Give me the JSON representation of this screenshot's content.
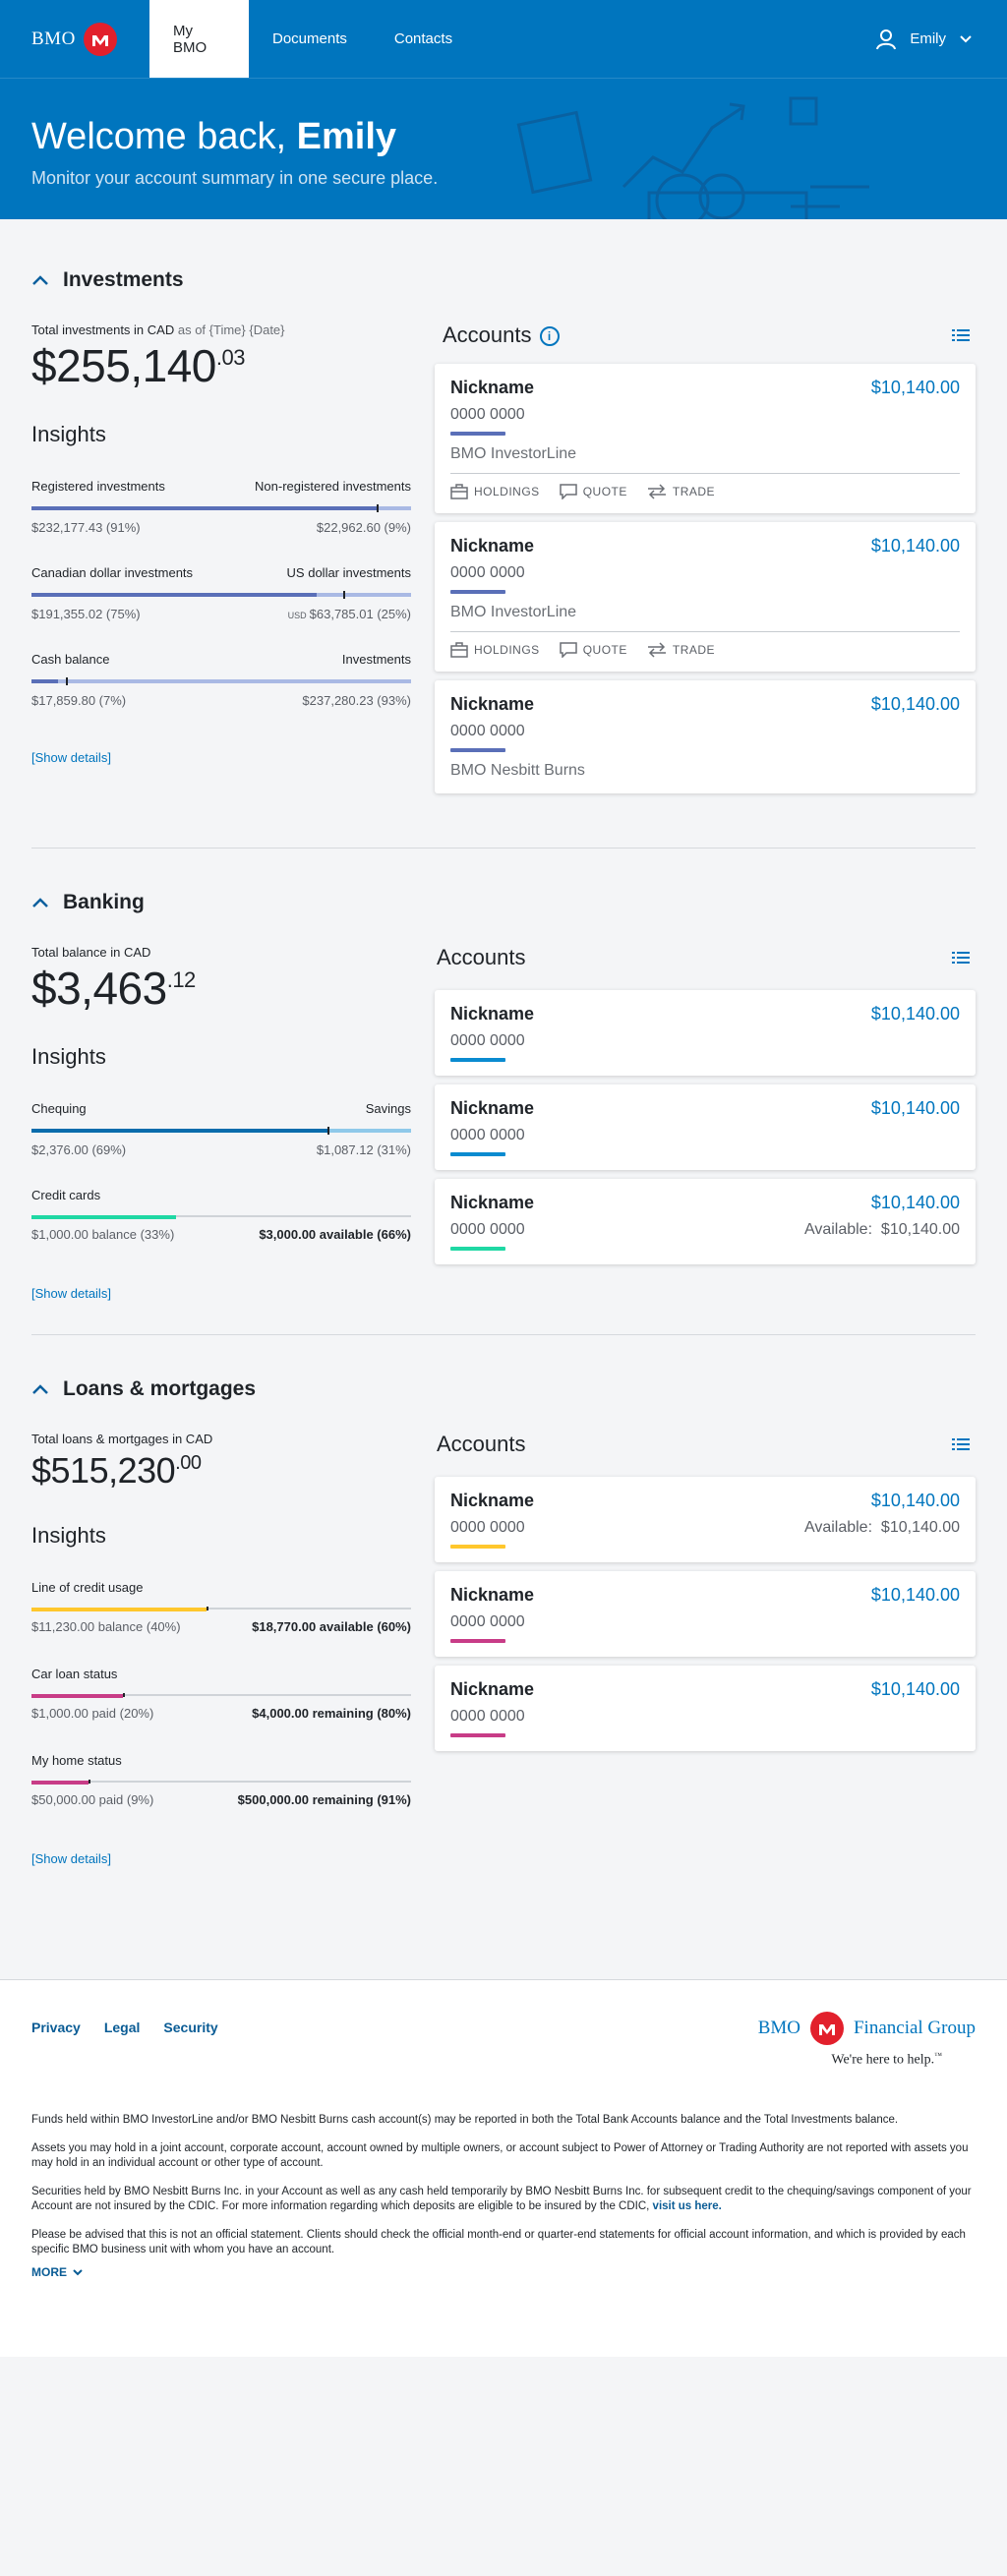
{
  "nav": {
    "brand": "BMO",
    "tabs": [
      "My BMO",
      "Documents",
      "Contacts"
    ],
    "user_name": "Emily"
  },
  "hero": {
    "greeting": "Welcome back,",
    "name": "Emily",
    "subtitle": "Monitor your account summary in one secure place."
  },
  "investments": {
    "title": "Investments",
    "total_label": "Total investments in CAD",
    "total_asof": "as of {Time} {Date}",
    "total_whole": "$255,140",
    "total_cents": ".03",
    "insights_title": "Insights",
    "insights": [
      {
        "left_label": "Registered investments",
        "right_label": "Non-registered investments",
        "left_value": "$232,177.43 (91%)",
        "right_value": "$22,962.60 (9%)",
        "fraction": 0.91
      },
      {
        "left_label": "Canadian dollar investments",
        "right_label": "US dollar investments",
        "left_value": "$191,355.02 (75%)",
        "right_currency": "USD",
        "right_value": "$63,785.01 (25%)",
        "fraction": 0.75
      },
      {
        "left_label": "Cash balance",
        "right_label": "Investments",
        "left_value": "$17,859.80 (7%)",
        "right_value": "$237,280.23 (93%)",
        "fraction": 0.07
      }
    ],
    "show_details": "[Show details]",
    "accounts_title": "Accounts",
    "accounts": [
      {
        "nickname": "Nickname",
        "amount": "$10,140.00",
        "number": "0000 0000",
        "provider": "BMO InvestorLine",
        "actions": [
          "HOLDINGS",
          "QUOTE",
          "TRADE"
        ]
      },
      {
        "nickname": "Nickname",
        "amount": "$10,140.00",
        "number": "0000 0000",
        "provider": "BMO InvestorLine",
        "actions": [
          "HOLDINGS",
          "QUOTE",
          "TRADE"
        ]
      },
      {
        "nickname": "Nickname",
        "amount": "$10,140.00",
        "number": "0000 0000",
        "provider": "BMO Nesbitt Burns"
      }
    ]
  },
  "banking": {
    "title": "Banking",
    "total_label": "Total balance in CAD",
    "total_whole": "$3,463",
    "total_cents": ".12",
    "insights_title": "Insights",
    "insights": [
      {
        "left_label": "Chequing",
        "right_label": "Savings",
        "left_value": "$2,376.00 (69%)",
        "right_value": "$1,087.12 (31%)",
        "fraction": 0.69
      },
      {
        "left_label": "Credit cards",
        "right_label": "",
        "left_value": "$1,000.00 balance (33%)",
        "right_value": "$3,000.00 available (66%)",
        "fraction": 0.33
      }
    ],
    "show_details": "[Show details]",
    "accounts_title": "Accounts",
    "accounts": [
      {
        "nickname": "Nickname",
        "amount": "$10,140.00",
        "number": "0000 0000"
      },
      {
        "nickname": "Nickname",
        "amount": "$10,140.00",
        "number": "0000 0000"
      },
      {
        "nickname": "Nickname",
        "amount": "$10,140.00",
        "number": "0000 0000",
        "available_label": "Available:",
        "available_value": "$10,140.00"
      }
    ]
  },
  "loans": {
    "title": "Loans & mortgages",
    "total_label": "Total loans & mortgages in CAD",
    "total_whole": "$515,230",
    "total_cents": ".00",
    "insights_title": "Insights",
    "insights": [
      {
        "left_label": "Line of credit usage",
        "left_value": "$11,230.00 balance (40%)",
        "right_value": "$18,770.00 available (60%)",
        "fraction": 0.4
      },
      {
        "left_label": "Car loan status",
        "left_value": "$1,000.00 paid (20%)",
        "right_value": "$4,000.00 remaining (80%)",
        "fraction": 0.2
      },
      {
        "left_label": "My home status",
        "left_value": "$50,000.00 paid (9%)",
        "right_value": "$500,000.00 remaining (91%)",
        "fraction": 0.09
      }
    ],
    "show_details": "[Show details]",
    "accounts_title": "Accounts",
    "accounts": [
      {
        "nickname": "Nickname",
        "amount": "$10,140.00",
        "number": "0000 0000",
        "available_label": "Available:",
        "available_value": "$10,140.00"
      },
      {
        "nickname": "Nickname",
        "amount": "$10,140.00",
        "number": "0000 0000"
      },
      {
        "nickname": "Nickname",
        "amount": "$10,140.00",
        "number": "0000 0000"
      }
    ]
  },
  "footer": {
    "links": [
      "Privacy",
      "Legal",
      "Security"
    ],
    "brand": "BMO",
    "brand_suffix": "Financial Group",
    "tagline": "We're here to help.",
    "tagline_mark": "™",
    "disclaimers": [
      "Funds held within BMO InvestorLine and/or BMO Nesbitt Burns cash account(s) may be reported in both the Total Bank Accounts balance and the Total Investments balance.",
      "Assets you may hold in a joint account, corporate account, account owned by multiple owners, or account subject to Power of Attorney or Trading Authority are not reported with assets you may hold in an individual account or other type of account.",
      "Securities held by BMO Nesbitt Burns Inc. in your Account as well as any cash held temporarily by BMO Nesbitt Burns Inc. for subsequent credit to the chequing/savings component of your Account are not insured by the CDIC. For more information regarding which deposits are eligible to be insured by the CDIC,",
      "Please be advised that this is not an official statement. Clients should check the official month-end or quarter-end statements for official account information, and which is provided by each specific BMO business unit with whom you have an account."
    ],
    "visit_link": "visit us here.",
    "more_label": "MORE"
  },
  "colors": {
    "brand_blue": "#0075be",
    "bmo_red": "#e2202c",
    "investments_bar": "#5a6fb8",
    "investments_track": "#a9b9e4",
    "chequing_bar": "#0a6cac",
    "savings_track": "#8fc9ea",
    "credit_bar": "#1fd8a4",
    "loc_bar": "#ffc72c",
    "loan_bar": "#c83c87",
    "track_grey": "#cfd3d8"
  }
}
